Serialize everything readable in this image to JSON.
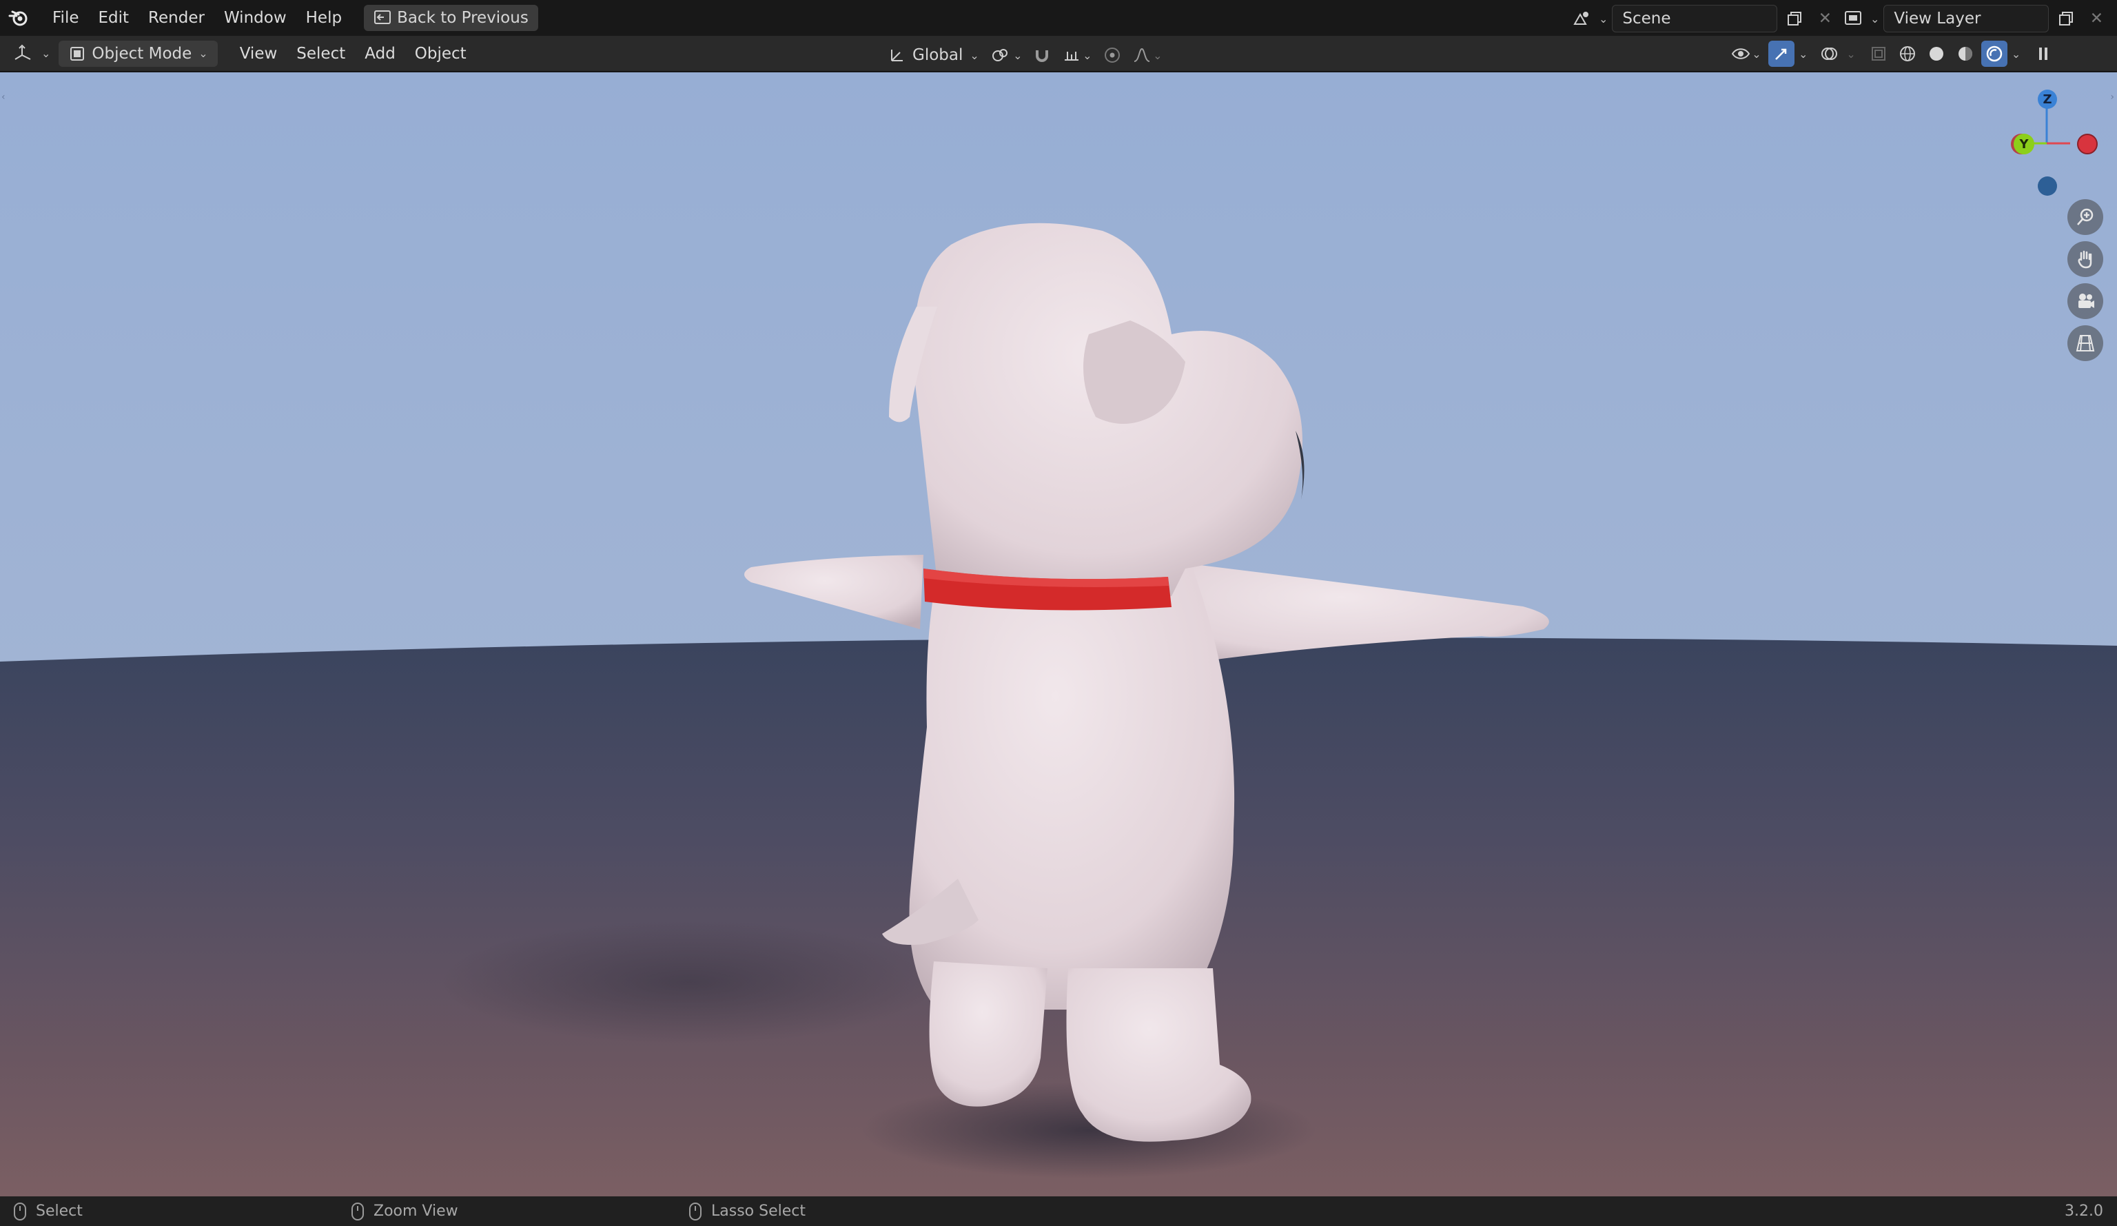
{
  "topbar": {
    "menus": [
      "File",
      "Edit",
      "Render",
      "Window",
      "Help"
    ],
    "back_button": "Back to Previous",
    "scene_name": "Scene",
    "view_layer_name": "View Layer"
  },
  "header": {
    "mode": "Object Mode",
    "menus": [
      "View",
      "Select",
      "Add",
      "Object"
    ],
    "transform_orientation": "Global"
  },
  "gizmo": {
    "z_label": "Z",
    "y_label": "Y"
  },
  "statusbar": {
    "left_action": "Select",
    "middle_action": "Zoom View",
    "right_action": "Lasso Select",
    "version": "3.2.0"
  },
  "colors": {
    "accent": "#4772b3",
    "axis_x": "#e04850",
    "axis_y": "#8ccf1a",
    "axis_z": "#3a82d6",
    "sky": "#a2b5d6",
    "ground_top": "#3c4661",
    "ground_bottom": "#7a5e62",
    "collar": "#d42a2a",
    "body": "#e6d9de"
  },
  "icons": {
    "app": "blender-logo-icon",
    "editor_type": "3d-viewport-icon",
    "mode": "object-mode-icon",
    "orientation": "transform-orientation-icon",
    "pivot": "pivot-point-icon",
    "snap": "magnet-snap-icon",
    "snap_target": "snap-increment-icon",
    "proportional": "proportional-edit-icon",
    "falloff": "falloff-curve-icon",
    "visibility": "eye-visibility-icon",
    "gizmo": "gizmo-toggle-icon",
    "overlay": "overlay-icon",
    "xray": "xray-toggle-icon",
    "shading": [
      "wireframe-shading-icon",
      "solid-shading-icon",
      "material-shading-icon",
      "rendered-shading-icon"
    ],
    "nav": [
      "zoom-icon",
      "pan-hand-icon",
      "camera-view-icon",
      "ortho-grid-icon"
    ]
  }
}
